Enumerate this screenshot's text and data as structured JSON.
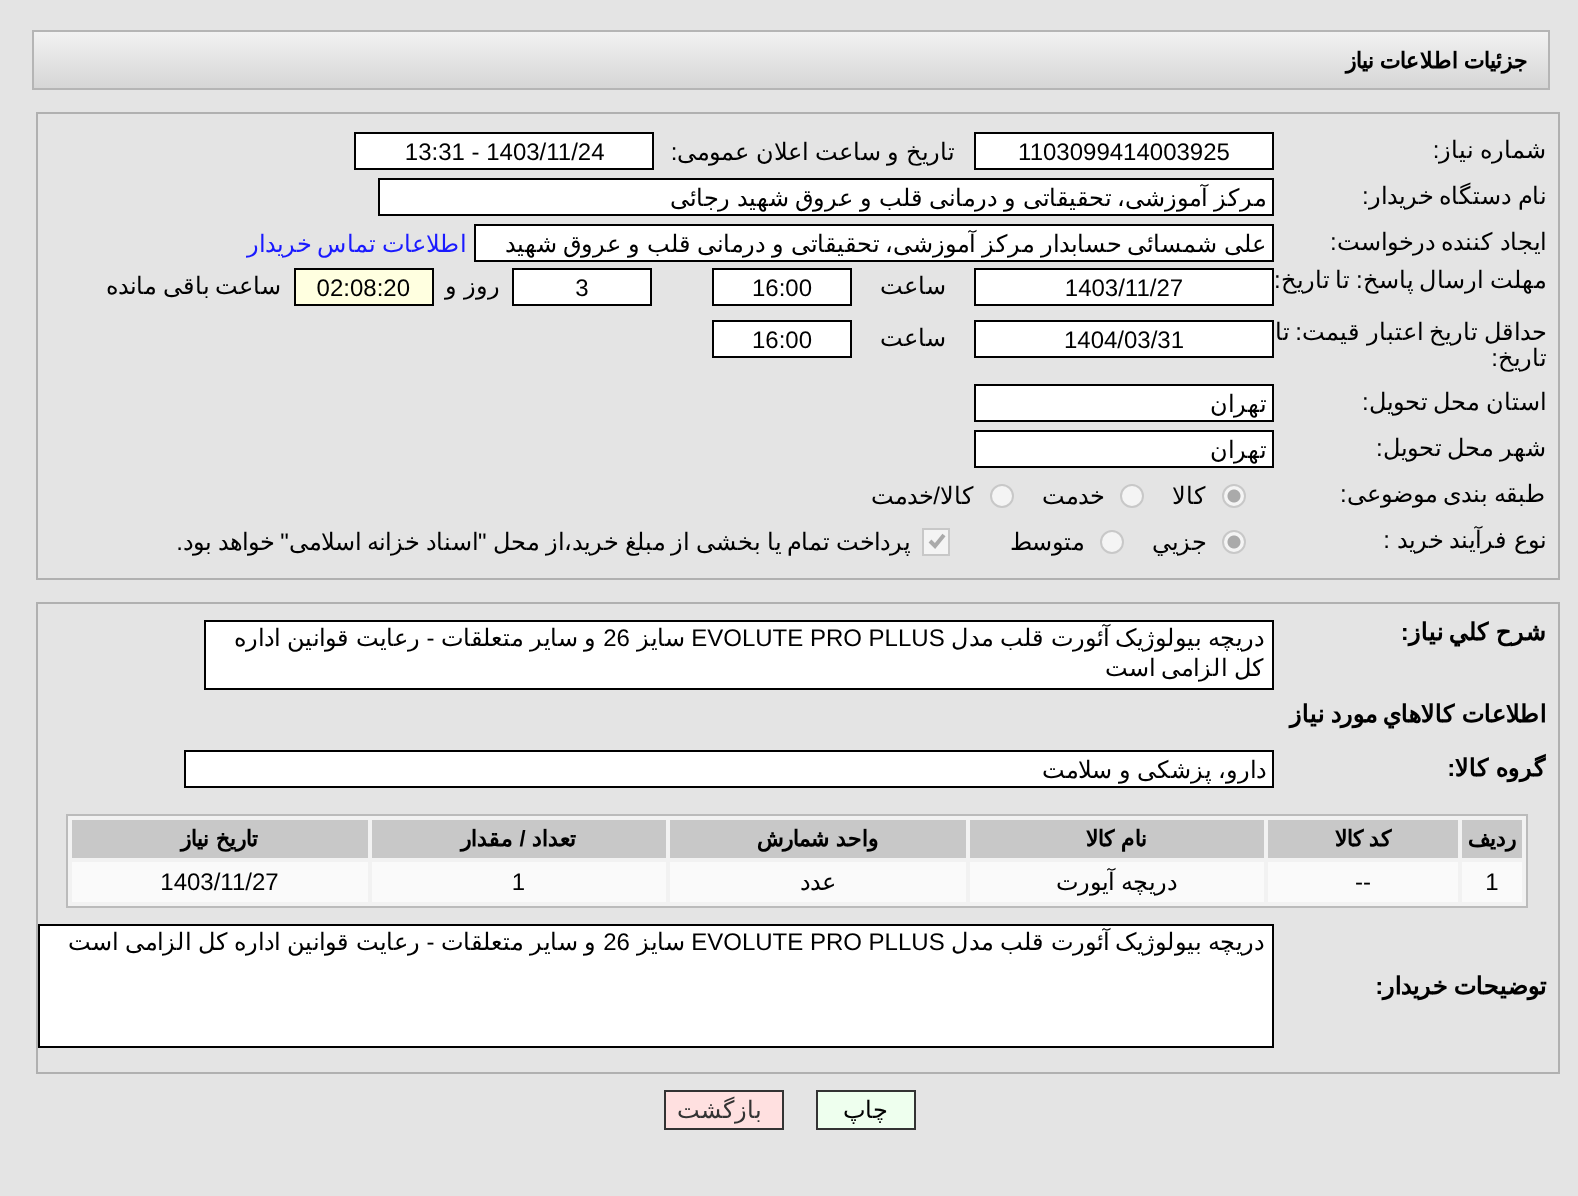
{
  "header": {
    "title": "جزئیات اطلاعات نیاز"
  },
  "details": {
    "need_number": {
      "label": "شماره نیاز:",
      "value": "1103099414003925"
    },
    "announce": {
      "label": "تاریخ و ساعت اعلان عمومی:",
      "value": "1403/11/24 - 13:31"
    },
    "buyer_org": {
      "label": "نام دستگاه خریدار:",
      "value": "مرکز آموزشی، تحقیقاتی و درمانی قلب و عروق شهید رجائی"
    },
    "creator": {
      "label": "ایجاد کننده درخواست:",
      "value": "علی شمسائی حسابدار مرکز آموزشی، تحقیقاتی و درمانی قلب و عروق شهید",
      "link": "اطلاعات تماس خریدار"
    },
    "deadline": {
      "label": "مهلت ارسال پاسخ: تا تاریخ:",
      "date": "1403/11/27",
      "time_label": "ساعت",
      "time": "16:00",
      "days": "3",
      "days_label": "روز و",
      "remaining": "02:08:20",
      "remaining_label": "ساعت باقی مانده"
    },
    "validity": {
      "label": "حداقل تاریخ اعتبار قیمت: تا تاریخ:",
      "date": "1404/03/31",
      "time_label": "ساعت",
      "time": "16:00"
    },
    "province": {
      "label": "استان محل تحویل:",
      "value": "تهران"
    },
    "city": {
      "label": "شهر محل تحویل:",
      "value": "تهران"
    },
    "category": {
      "label": "طبقه بندی موضوعی:",
      "options": [
        {
          "label": "کالا",
          "selected": true
        },
        {
          "label": "خدمت",
          "selected": false
        },
        {
          "label": "کالا/خدمت",
          "selected": false
        }
      ]
    },
    "process": {
      "label": "نوع فرآیند خرید :",
      "options": [
        {
          "label": "جزیي",
          "selected": true
        },
        {
          "label": "متوسط",
          "selected": false
        }
      ],
      "payment": {
        "checked": true,
        "text": "پرداخت تمام یا بخشی از مبلغ خرید،از محل \"اسناد خزانه اسلامی\" خواهد بود."
      }
    }
  },
  "needs": {
    "description": {
      "label": "شرح کلي نياز:",
      "value": "دریچه بیولوژیک آئورت قلب مدل EVOLUTE  PRO PLLUS سایز 26 و سایر متعلقات - رعایت قوانین اداره کل الزامی است"
    },
    "goods_heading": "اطلاعات کالاهاي مورد نياز",
    "group": {
      "label": "گروه کالا:",
      "value": "دارو، پزشکی و سلامت"
    },
    "table": {
      "columns": [
        "ردیف",
        "کد کالا",
        "نام کالا",
        "واحد شمارش",
        "تعداد / مقدار",
        "تاریخ نیاز"
      ],
      "rows": [
        [
          "1",
          "--",
          "دریچه آیورت",
          "عدد",
          "1",
          "1403/11/27"
        ]
      ]
    },
    "notes": {
      "label": "توضیحات خریدار:",
      "value": "دریچه بیولوژیک آئورت قلب مدل EVOLUTE  PRO PLLUS سایز 26 و سایر متعلقات - رعایت قوانین اداره کل الزامی است"
    }
  },
  "buttons": [
    {
      "label": "چاپ",
      "kind": "print"
    },
    {
      "label": "بازگشت",
      "kind": "back"
    }
  ]
}
